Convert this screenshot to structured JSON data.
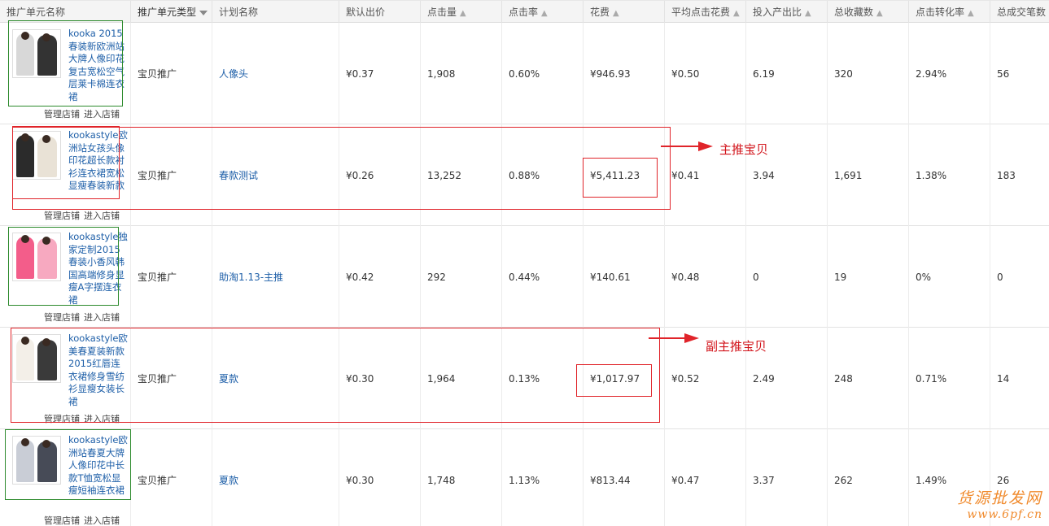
{
  "columns": {
    "item_name": "推广单元名称",
    "unit_type": "推广单元类型",
    "plan_name": "计划名称",
    "default_bid": "默认出价",
    "clicks": "点击量",
    "ctr": "点击率",
    "cost": "花费",
    "avg_cpc": "平均点击花费",
    "roi": "投入产出比",
    "favorites": "总收藏数",
    "cvr": "点击转化率",
    "orders": "总成交笔数"
  },
  "rows": [
    {
      "title": "kooka 2015春装新欧洲站大牌人像印花复古宽松空气层莱卡棉连衣裙",
      "manage": "管理店铺",
      "enter": "进入店铺",
      "unit_type": "宝贝推广",
      "plan": "人像头",
      "bid": "¥0.37",
      "clicks": "1,908",
      "ctr": "0.60%",
      "cost": "¥946.93",
      "cpc": "¥0.50",
      "roi": "6.19",
      "favorites": "320",
      "cvr": "2.94%",
      "orders": "56"
    },
    {
      "title": "kookastyle欧洲站女孩头像印花超长款衬衫连衣裙宽松显瘦春装新款",
      "manage": "管理店铺",
      "enter": "进入店铺",
      "unit_type": "宝贝推广",
      "plan": "春款测试",
      "bid": "¥0.26",
      "clicks": "13,252",
      "ctr": "0.88%",
      "cost": "¥5,411.23",
      "cpc": "¥0.41",
      "roi": "3.94",
      "favorites": "1,691",
      "cvr": "1.38%",
      "orders": "183"
    },
    {
      "title": "kookastyle独家定制2015春装小香风韩国高端修身显瘦A字摆连衣裙",
      "manage": "管理店铺",
      "enter": "进入店铺",
      "unit_type": "宝贝推广",
      "plan": "助淘1.13-主推",
      "bid": "¥0.42",
      "clicks": "292",
      "ctr": "0.44%",
      "cost": "¥140.61",
      "cpc": "¥0.48",
      "roi": "0",
      "favorites": "19",
      "cvr": "0%",
      "orders": "0"
    },
    {
      "title": "kookastyle欧美春夏装新款2015红唇连衣裙修身雪纺衫显瘦女装长裙",
      "manage": "管理店铺",
      "enter": "进入店铺",
      "unit_type": "宝贝推广",
      "plan": "夏款",
      "bid": "¥0.30",
      "clicks": "1,964",
      "ctr": "0.13%",
      "cost": "¥1,017.97",
      "cpc": "¥0.52",
      "roi": "2.49",
      "favorites": "248",
      "cvr": "0.71%",
      "orders": "14"
    },
    {
      "title": "kookastyle欧洲站春夏大牌人像印花中长款T恤宽松显瘦短袖连衣裙",
      "manage": "管理店铺",
      "enter": "进入店铺",
      "unit_type": "宝贝推广",
      "plan": "夏款",
      "bid": "¥0.30",
      "clicks": "1,748",
      "ctr": "1.13%",
      "cost": "¥813.44",
      "cpc": "¥0.47",
      "roi": "3.37",
      "favorites": "262",
      "cvr": "1.49%",
      "orders": "26"
    }
  ],
  "annotations": {
    "main": "主推宝贝",
    "secondary": "副主推宝贝"
  },
  "watermark": {
    "line1": "货源批发网",
    "line2": "www.6pf.cn"
  },
  "colors": {
    "link": "#1e5fa8",
    "annotation": "#d2141b",
    "green_box": "#2c8a2c",
    "watermark": "#f08a2c"
  }
}
